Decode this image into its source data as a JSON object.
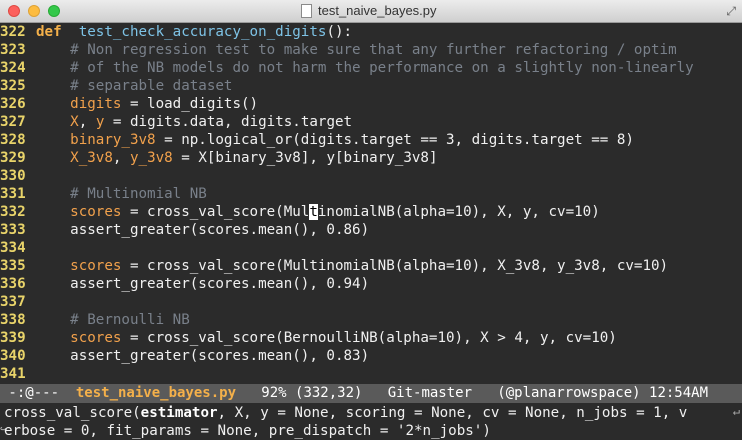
{
  "window": {
    "title": "test_naive_bayes.py"
  },
  "code": [
    {
      "n": "322",
      "segs": [
        [
          "kw",
          "def"
        ],
        [
          "",
          "  "
        ],
        [
          "fn",
          "test_check_accuracy_on_digits"
        ],
        [
          "",
          "():"
        ]
      ]
    },
    {
      "n": "323",
      "segs": [
        [
          "",
          "    "
        ],
        [
          "cm",
          "# Non regression test to make sure that any further refactoring / optim"
        ]
      ]
    },
    {
      "n": "324",
      "segs": [
        [
          "",
          "    "
        ],
        [
          "cm",
          "# of the NB models do not harm the performance on a slightly non-linearly"
        ]
      ]
    },
    {
      "n": "325",
      "segs": [
        [
          "",
          "    "
        ],
        [
          "cm",
          "# separable dataset"
        ]
      ]
    },
    {
      "n": "326",
      "segs": [
        [
          "",
          "    "
        ],
        [
          "vr",
          "digits"
        ],
        [
          "",
          " = load_digits()"
        ]
      ]
    },
    {
      "n": "327",
      "segs": [
        [
          "",
          "    "
        ],
        [
          "vr",
          "X"
        ],
        [
          "",
          ", "
        ],
        [
          "vr",
          "y"
        ],
        [
          "",
          " = digits.data, digits.target"
        ]
      ]
    },
    {
      "n": "328",
      "segs": [
        [
          "",
          "    "
        ],
        [
          "vr",
          "binary_3v8"
        ],
        [
          "",
          " = np.logical_or(digits.target == 3, digits.target == 8)"
        ]
      ]
    },
    {
      "n": "329",
      "segs": [
        [
          "",
          "    "
        ],
        [
          "vr",
          "X_3v8"
        ],
        [
          "",
          ", "
        ],
        [
          "vr",
          "y_3v8"
        ],
        [
          "",
          " = X[binary_3v8], y[binary_3v8]"
        ]
      ]
    },
    {
      "n": "330",
      "segs": []
    },
    {
      "n": "331",
      "segs": [
        [
          "",
          "    "
        ],
        [
          "cm",
          "# Multinomial NB"
        ]
      ]
    },
    {
      "n": "332",
      "segs": [
        [
          "",
          "    "
        ],
        [
          "vr",
          "scores"
        ],
        [
          "",
          " = cross_val_score(Mul"
        ],
        [
          "cursor",
          "t"
        ],
        [
          "",
          "inomialNB(alpha=10), X, y, cv=10)"
        ]
      ]
    },
    {
      "n": "333",
      "segs": [
        [
          "",
          "    assert_greater(scores.mean(), 0.86)"
        ]
      ]
    },
    {
      "n": "334",
      "segs": []
    },
    {
      "n": "335",
      "segs": [
        [
          "",
          "    "
        ],
        [
          "vr",
          "scores"
        ],
        [
          "",
          " = cross_val_score(MultinomialNB(alpha=10), X_3v8, y_3v8, cv=10)"
        ]
      ]
    },
    {
      "n": "336",
      "segs": [
        [
          "",
          "    assert_greater(scores.mean(), 0.94)"
        ]
      ]
    },
    {
      "n": "337",
      "segs": []
    },
    {
      "n": "338",
      "segs": [
        [
          "",
          "    "
        ],
        [
          "cm",
          "# Bernoulli NB"
        ]
      ]
    },
    {
      "n": "339",
      "segs": [
        [
          "",
          "    "
        ],
        [
          "vr",
          "scores"
        ],
        [
          "",
          " = cross_val_score(BernoulliNB(alpha=10), X > 4, y, cv=10)"
        ]
      ]
    },
    {
      "n": "340",
      "segs": [
        [
          "",
          "    assert_greater(scores.mean(), 0.83)"
        ]
      ]
    },
    {
      "n": "341",
      "segs": []
    }
  ],
  "modeline": {
    "status": " -:@---  ",
    "buffer": "test_naive_bayes.py",
    "info": "   92% (332,32)   Git-master   (@planarrowspace) 12:54AM"
  },
  "echo": {
    "line1_pre": "cross_val_score(",
    "line1_bold": "estimator",
    "line1_post": ", X, y = None, scoring = None, cv = None, n_jobs = 1, v",
    "line2": "erbose = 0, fit_params = None, pre_dispatch = '2*n_jobs')"
  }
}
